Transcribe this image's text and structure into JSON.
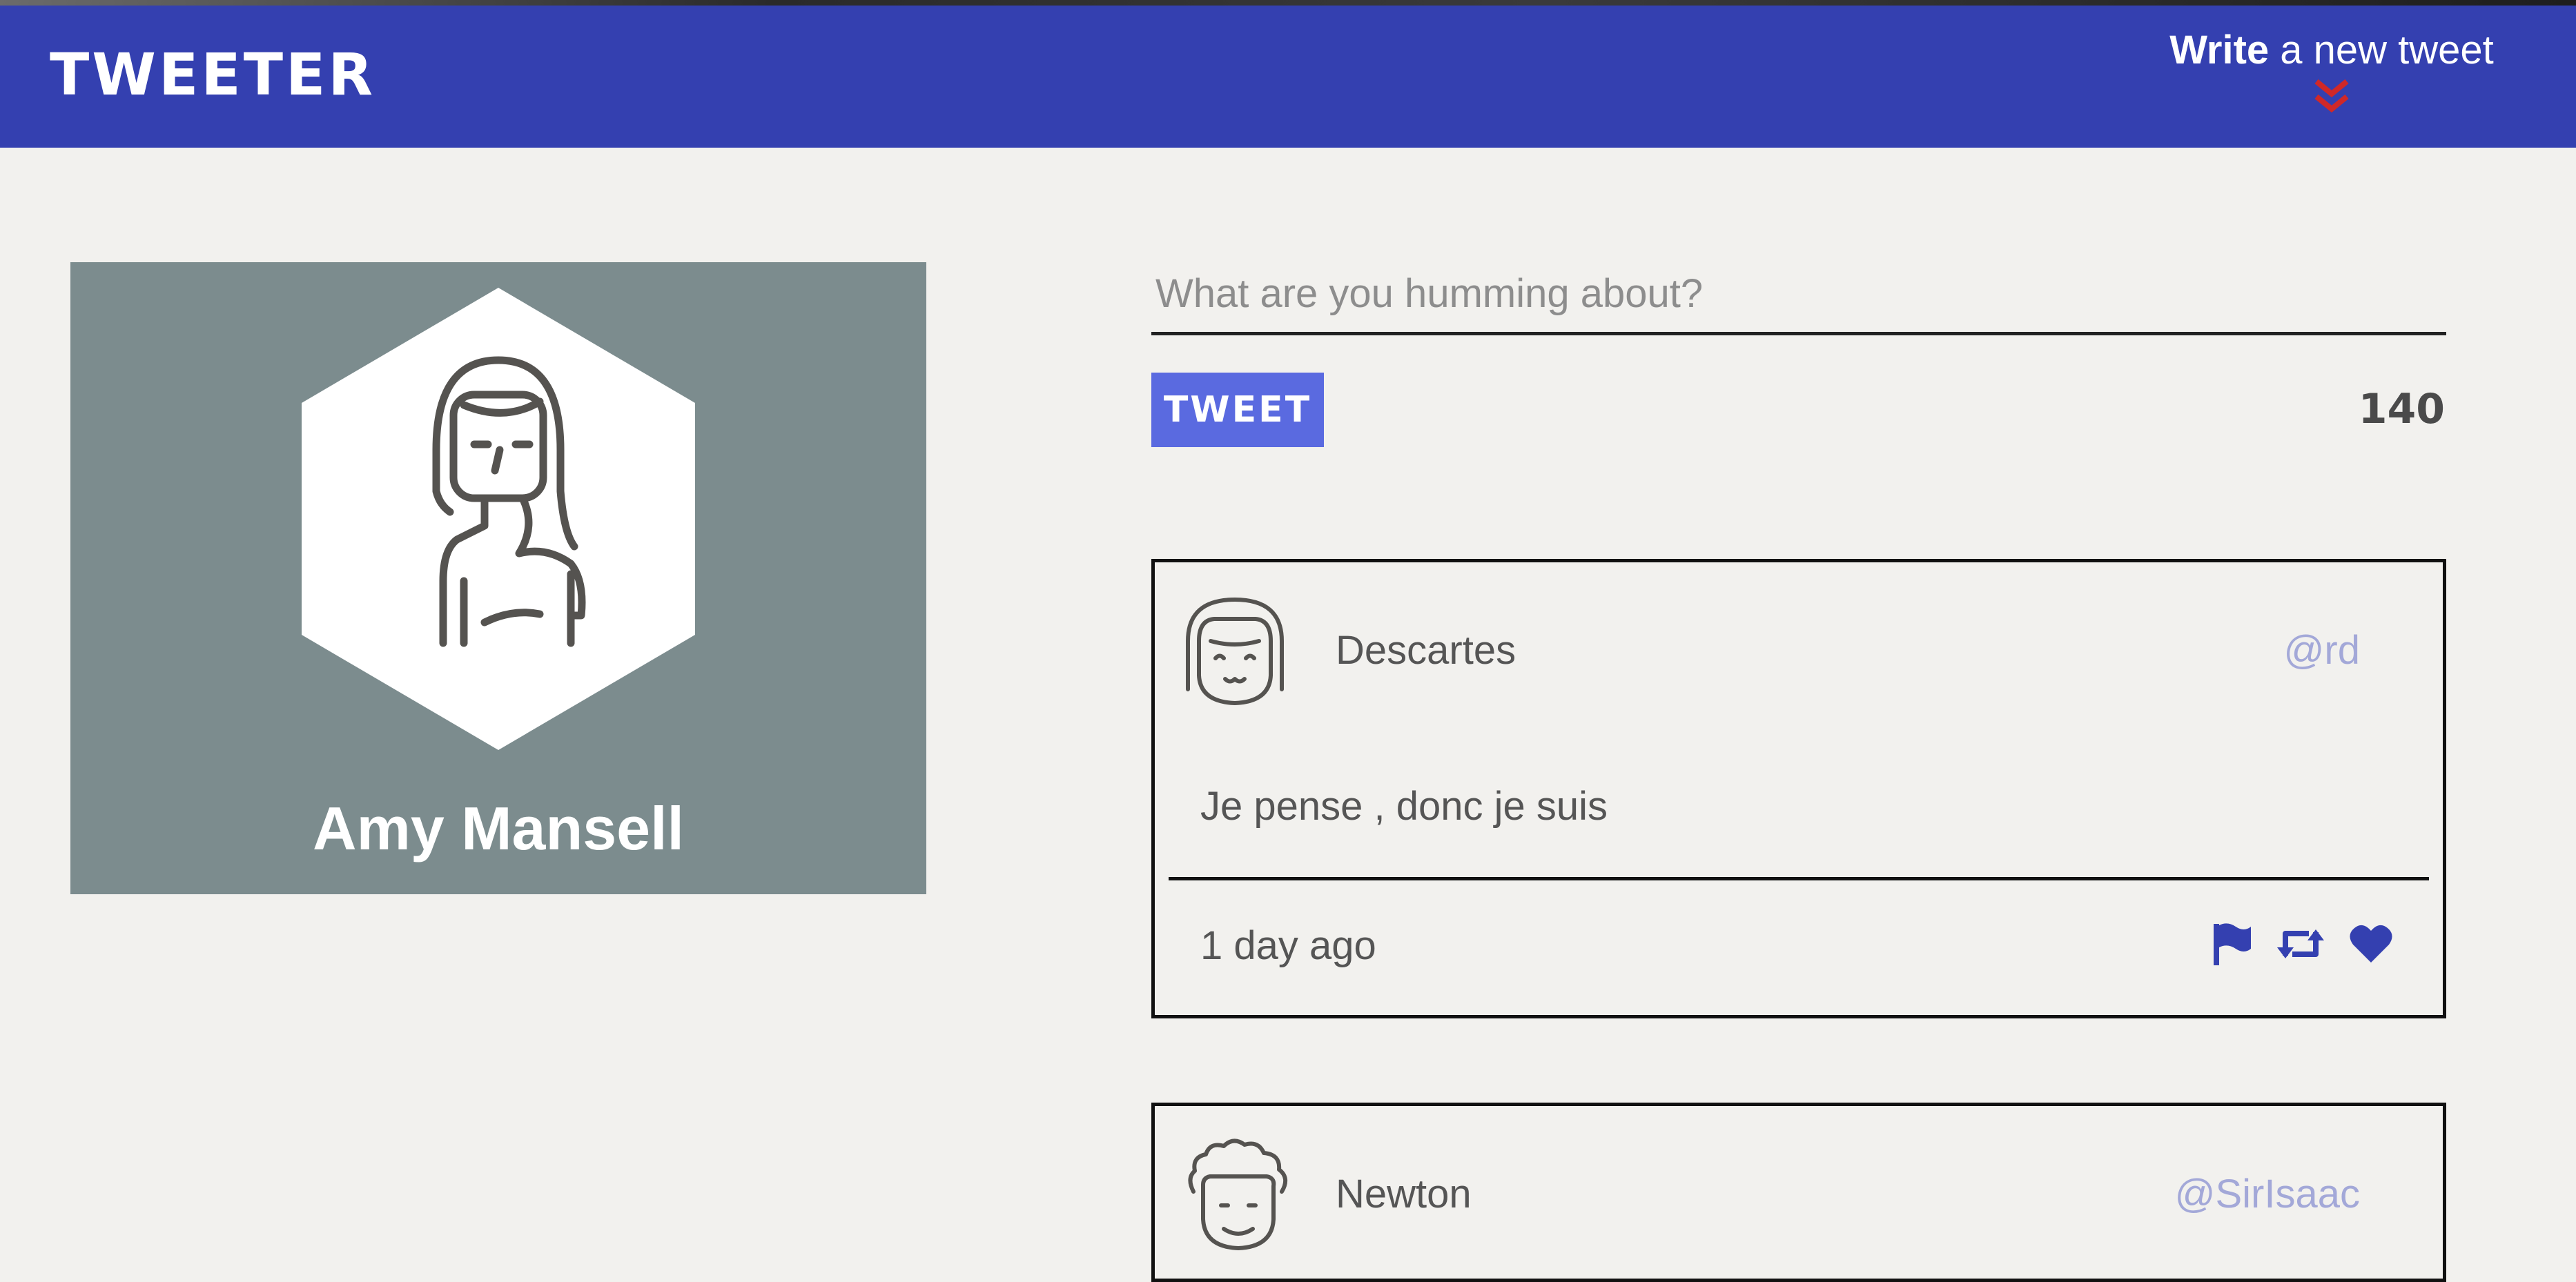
{
  "navbar": {
    "logo": "TWEETER",
    "compose_bold": "Write",
    "compose_rest": " a new tweet",
    "compose_icon": "double-chevron-down-icon"
  },
  "profile": {
    "name": "Amy Mansell",
    "avatar_icon": "woman-avatar-icon"
  },
  "composer": {
    "placeholder": "What are you humming about?",
    "value": "",
    "button_label": "TWEET",
    "char_count": "140"
  },
  "tweets": [
    {
      "author": "Descartes",
      "handle": "@rd",
      "body": "Je pense , donc je suis",
      "time": "1 day ago",
      "avatar_icon": "girl-avatar-icon",
      "actions": [
        "flag-icon",
        "retweet-icon",
        "heart-icon"
      ]
    },
    {
      "author": "Newton",
      "handle": "@SirIsaac",
      "avatar_icon": "curly-hair-avatar-icon"
    }
  ],
  "colors": {
    "navbar": "#3440b0",
    "accent_button": "#5a6ae0",
    "chevron": "#d02828",
    "profile_card": "#7c8c8e",
    "handle": "#a3a8d8",
    "action_icon": "#3440b0",
    "background": "#f2f1ee"
  }
}
